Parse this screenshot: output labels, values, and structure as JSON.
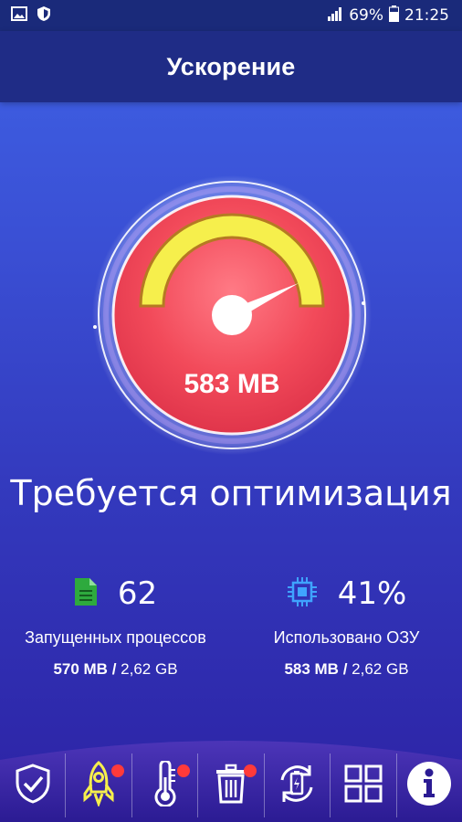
{
  "status_bar": {
    "battery_percent": "69%",
    "time": "21:25",
    "icons": [
      "gallery-icon",
      "shield-icon",
      "signal-icon",
      "battery-icon"
    ]
  },
  "app_bar": {
    "title": "Ускорение"
  },
  "gauge": {
    "value_label": "583 MB",
    "fraction": 0.41,
    "colors": {
      "ball": "#f24a5a",
      "arc": "#f6ef4c",
      "arc_border": "#b57a22"
    }
  },
  "status_text": "Требуется оптимизация",
  "stats": {
    "processes": {
      "count": "62",
      "label": "Запущенных процессов",
      "used": "570 MB",
      "separator": "/",
      "total": "2,62 GB",
      "icon": "document-icon",
      "icon_color": "#2eaa3e"
    },
    "ram": {
      "percent": "41%",
      "label": "Использовано ОЗУ",
      "used": "583 MB",
      "separator": "/",
      "total": "2,62 GB",
      "icon": "cpu-chip-icon",
      "icon_color": "#3fa3ff"
    }
  },
  "nav": {
    "items": [
      {
        "icon": "shield-check-icon",
        "badge": false
      },
      {
        "icon": "rocket-icon",
        "badge": true,
        "active": true
      },
      {
        "icon": "thermometer-icon",
        "badge": true
      },
      {
        "icon": "trash-icon",
        "badge": true
      },
      {
        "icon": "battery-refresh-icon",
        "badge": false
      },
      {
        "icon": "grid-icon",
        "badge": false
      },
      {
        "icon": "info-icon",
        "badge": false
      }
    ],
    "badge_color": "#ff3a3a",
    "active_color": "#f6ef4c"
  }
}
